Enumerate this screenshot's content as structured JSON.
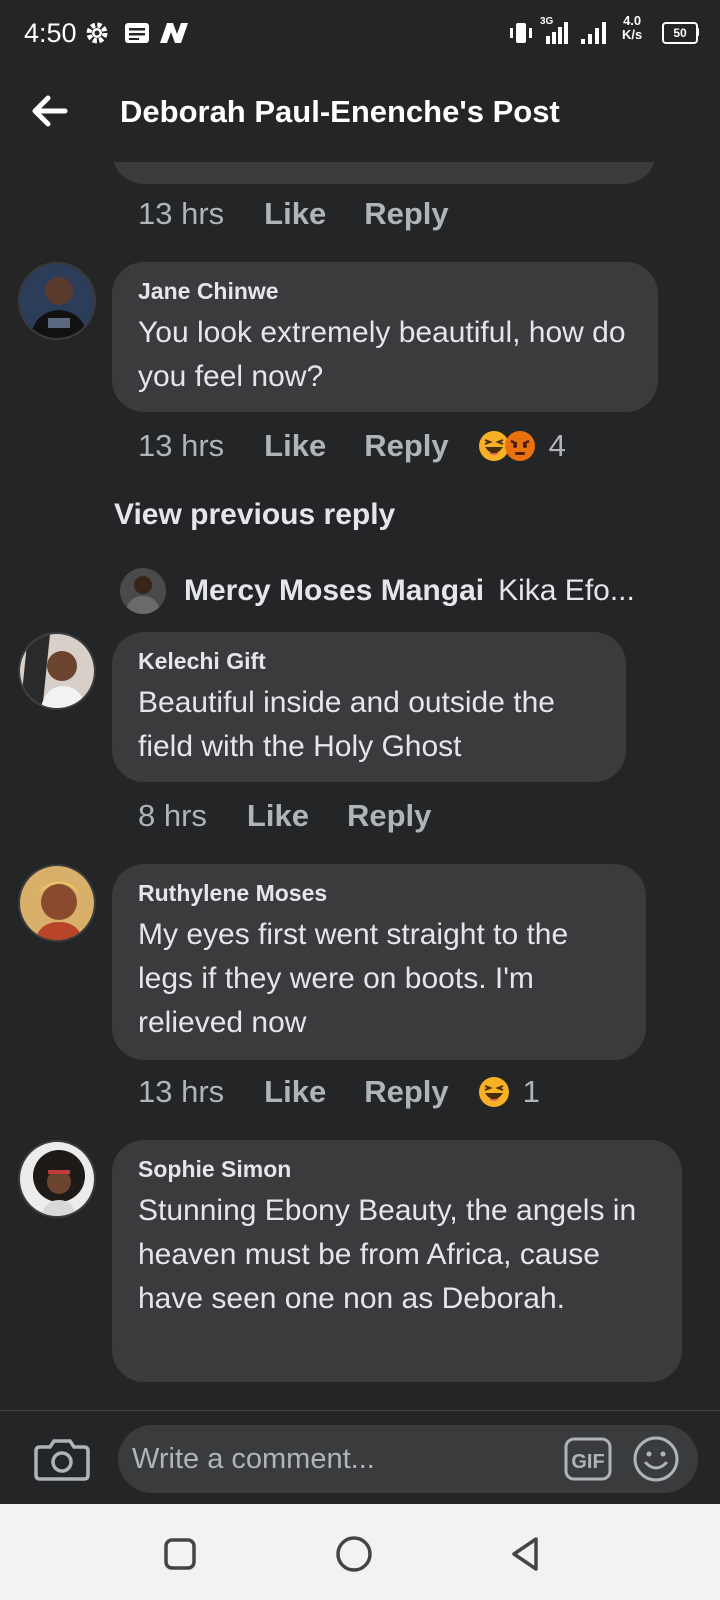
{
  "status_bar": {
    "time": "4:50",
    "network_speed_value": "4.0",
    "network_speed_unit": "K/s",
    "battery": "50",
    "mobile_data": "3G"
  },
  "header": {
    "title": "Deborah Paul-Enenche's Post"
  },
  "prev_comment": {
    "time": "13 hrs",
    "like": "Like",
    "reply": "Reply"
  },
  "comments": [
    {
      "author": "Jane Chinwe",
      "text": "You look extremely beautiful, how do you feel now?",
      "time": "13 hrs",
      "like": "Like",
      "reply": "Reply",
      "reaction_count": "4",
      "reactions": [
        "haha",
        "angry"
      ]
    },
    {
      "author": "Kelechi Gift",
      "text": "Beautiful inside and outside the field with the Holy Ghost",
      "time": "8 hrs",
      "like": "Like",
      "reply": "Reply"
    },
    {
      "author": "Ruthylene Moses",
      "text": "My eyes first went straight to the legs if they were on boots. I'm relieved now",
      "time": "13 hrs",
      "like": "Like",
      "reply": "Reply",
      "reaction_count": "1",
      "reactions": [
        "haha"
      ]
    },
    {
      "author": "Sophie Simon",
      "text": "Stunning Ebony Beauty, the angels in heaven must be from Africa, cause have seen one non as Deborah."
    }
  ],
  "view_previous": "View previous reply",
  "reply_preview": {
    "name": "Mercy Moses Mangai",
    "snippet": "Kika Efo..."
  },
  "composer": {
    "placeholder": "Write a comment...",
    "gif_label": "GIF"
  },
  "colors": {
    "background": "#242526",
    "bubble": "#3a3b3c",
    "text": "#e4e6eb",
    "muted": "#b0b3b8",
    "haha": "#f7b125",
    "angry": "#e9710f"
  }
}
